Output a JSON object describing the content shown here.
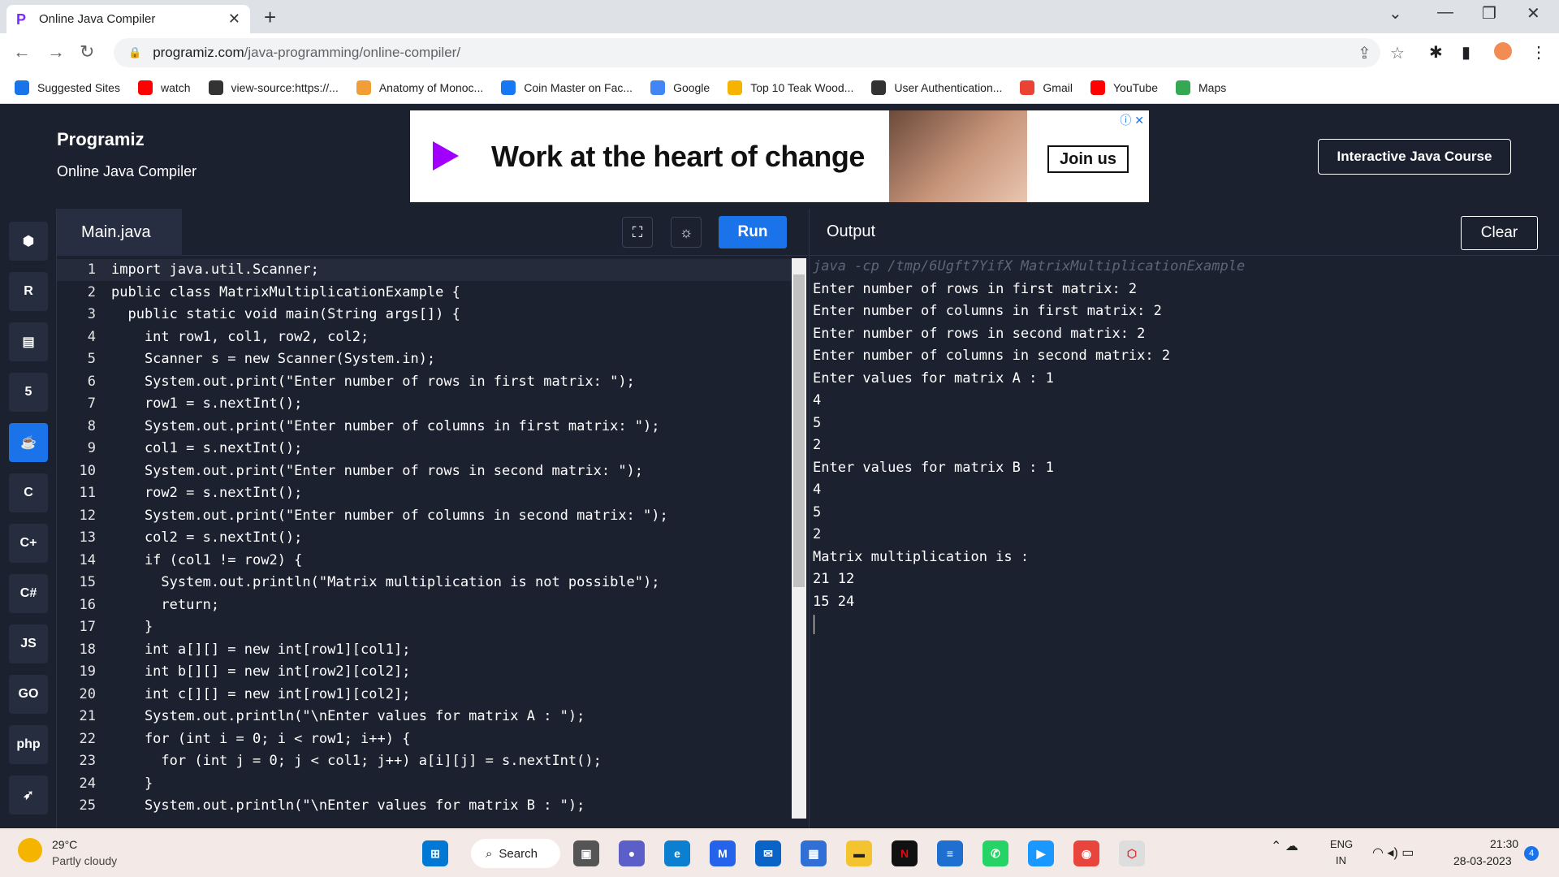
{
  "browser": {
    "tab_title": "Online Java Compiler",
    "url_host": "programiz.com",
    "url_path": "/java-programming/online-compiler/",
    "bookmarks": [
      {
        "label": "Suggested Sites",
        "color": "#1a73e8"
      },
      {
        "label": "watch",
        "color": "#ff0000"
      },
      {
        "label": "view-source:https://...",
        "color": "#333333"
      },
      {
        "label": "Anatomy of Monoc...",
        "color": "#f29e38"
      },
      {
        "label": "Coin Master on Fac...",
        "color": "#1877f2"
      },
      {
        "label": "Google",
        "color": "#4285f4"
      },
      {
        "label": "Top 10 Teak Wood...",
        "color": "#f5b400"
      },
      {
        "label": "User Authentication...",
        "color": "#333333"
      },
      {
        "label": "Gmail",
        "color": "#ea4335"
      },
      {
        "label": "YouTube",
        "color": "#ff0000"
      },
      {
        "label": "Maps",
        "color": "#34a853"
      }
    ]
  },
  "header": {
    "logo": "Programiz",
    "subtitle": "Online Java Compiler",
    "ad_headline": "Work at the heart of change",
    "ad_cta": "Join us",
    "course_button": "Interactive Java Course"
  },
  "sidebar": {
    "languages": [
      "python",
      "r",
      "sql",
      "html",
      "java",
      "c",
      "cpp",
      "csharp",
      "JS",
      "GO",
      "php",
      "swift"
    ]
  },
  "editor": {
    "filename": "Main.java",
    "run_label": "Run",
    "lines": [
      {
        "n": "1",
        "code": "import java.util.Scanner;"
      },
      {
        "n": "2",
        "code": "public class MatrixMultiplicationExample {"
      },
      {
        "n": "3",
        "code": "  public static void main(String args[]) {"
      },
      {
        "n": "4",
        "code": "    int row1, col1, row2, col2;"
      },
      {
        "n": "5",
        "code": "    Scanner s = new Scanner(System.in);"
      },
      {
        "n": "6",
        "code": "    System.out.print(\"Enter number of rows in first matrix: \");"
      },
      {
        "n": "7",
        "code": "    row1 = s.nextInt();"
      },
      {
        "n": "8",
        "code": "    System.out.print(\"Enter number of columns in first matrix: \");"
      },
      {
        "n": "9",
        "code": "    col1 = s.nextInt();"
      },
      {
        "n": "10",
        "code": "    System.out.print(\"Enter number of rows in second matrix: \");"
      },
      {
        "n": "11",
        "code": "    row2 = s.nextInt();"
      },
      {
        "n": "12",
        "code": "    System.out.print(\"Enter number of columns in second matrix: \");"
      },
      {
        "n": "13",
        "code": "    col2 = s.nextInt();"
      },
      {
        "n": "14",
        "code": "    if (col1 != row2) {"
      },
      {
        "n": "15",
        "code": "      System.out.println(\"Matrix multiplication is not possible\");"
      },
      {
        "n": "16",
        "code": "      return;"
      },
      {
        "n": "17",
        "code": "    }"
      },
      {
        "n": "18",
        "code": "    int a[][] = new int[row1][col1];"
      },
      {
        "n": "19",
        "code": "    int b[][] = new int[row2][col2];"
      },
      {
        "n": "20",
        "code": "    int c[][] = new int[row1][col2];"
      },
      {
        "n": "21",
        "code": "    System.out.println(\"\\nEnter values for matrix A : \");"
      },
      {
        "n": "22",
        "code": "    for (int i = 0; i < row1; i++) {"
      },
      {
        "n": "23",
        "code": "      for (int j = 0; j < col1; j++) a[i][j] = s.nextInt();"
      },
      {
        "n": "24",
        "code": "    }"
      },
      {
        "n": "25",
        "code": "    System.out.println(\"\\nEnter values for matrix B : \");"
      }
    ]
  },
  "output": {
    "title": "Output",
    "clear_label": "Clear",
    "command": "java -cp /tmp/6Ugft7YifX MatrixMultiplicationExample",
    "lines": [
      "Enter number of rows in first matrix: 2",
      "Enter number of columns in first matrix: 2",
      "Enter number of rows in second matrix: 2",
      "Enter number of columns in second matrix: 2",
      "Enter values for matrix A : 1",
      "4",
      "5",
      "2",
      "Enter values for matrix B : 1",
      "4",
      "5",
      "2",
      "Matrix multiplication is :",
      "21 12",
      "15 24"
    ]
  },
  "taskbar": {
    "temperature": "29°C",
    "weather": "Partly cloudy",
    "search_label": "Search",
    "lang_primary": "ENG",
    "lang_secondary": "IN",
    "time": "21:30",
    "date": "28-03-2023",
    "notification_count": "4"
  }
}
